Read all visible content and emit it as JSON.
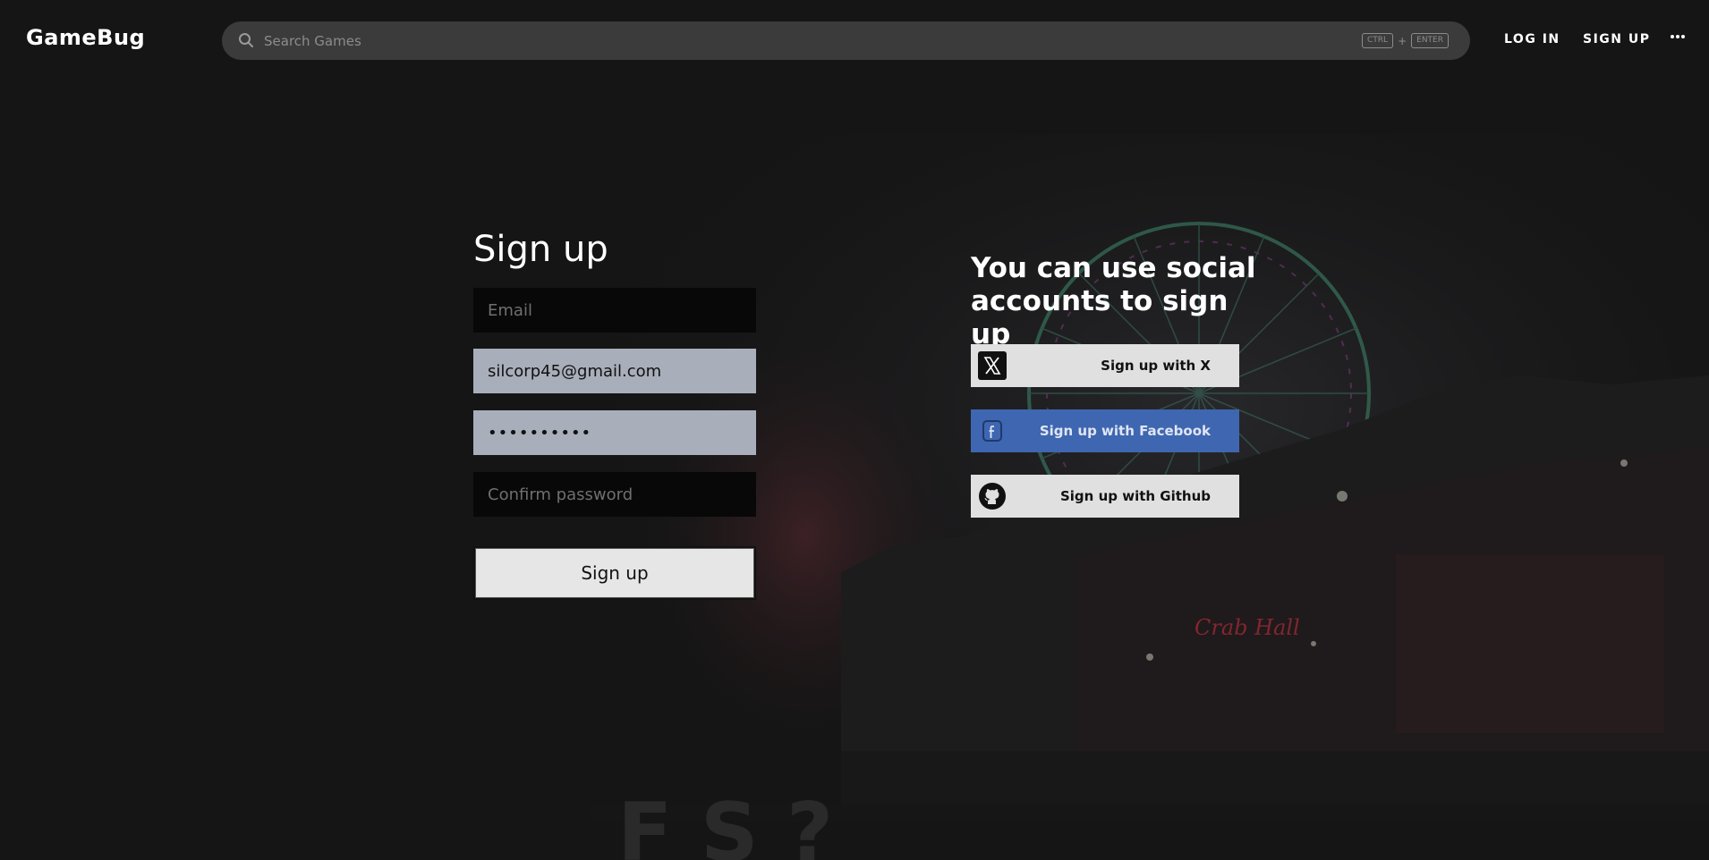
{
  "header": {
    "logo": "GameBug",
    "search_placeholder": "Search Games",
    "shortcut_key_1": "CTRL",
    "shortcut_plus": "+",
    "shortcut_key_2": "ENTER",
    "login_label": "LOG IN",
    "signup_label": "SIGN UP",
    "more_icon": "more-horizontal-icon"
  },
  "form": {
    "title": "Sign up",
    "email_placeholder": "Email",
    "email_value": "",
    "username_value": "silcorp45@gmail.com",
    "password_value": "••••••••••",
    "confirm_placeholder": "Confirm password",
    "submit_label": "Sign up"
  },
  "social": {
    "title": "You can use social accounts to sign up",
    "buttons": [
      {
        "label": "Sign up with X",
        "icon": "x-logo-icon"
      },
      {
        "label": "Sign up with Facebook",
        "icon": "facebook-logo-icon"
      },
      {
        "label": "Sign up with Github",
        "icon": "github-logo-icon"
      }
    ]
  },
  "colors": {
    "background": "#151515",
    "search_bg": "#3b3b3b",
    "filled_field": "#a9aebb",
    "facebook": "#3f66b0",
    "social_button": "#e0e0e0"
  }
}
